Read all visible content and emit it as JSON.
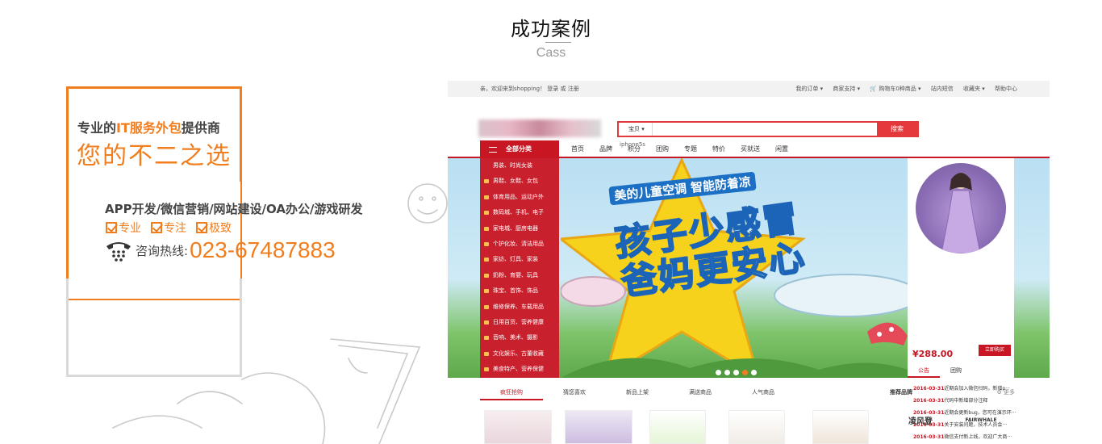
{
  "section": {
    "title": "成功案例",
    "subtitle": "Cass"
  },
  "card": {
    "line1_pre": "专业的",
    "line1_hl": "IT服务外包",
    "line1_post": "提供商",
    "line2": "您的不二之选",
    "services": "APP开发/微信营销/网站建设/OA办公/游戏研发",
    "tags": [
      "专业",
      "专注",
      "极致"
    ],
    "hotline_label": "咨询热线:",
    "hotline_number": "023-67487883"
  },
  "shop": {
    "topbar_left": "亲，欢迎来到shopping！ 登录  或  注册",
    "topbar_right": [
      "我的订单 ▾",
      "商家支持 ▾",
      "🛒 购物车0种商品  ▾",
      "站内短信",
      "收藏夹  ▾",
      "帮助中心"
    ],
    "search_category": "宝贝 ▾",
    "search_button": "搜索",
    "hot_word": "iphone5s",
    "all_categories": "全部分类",
    "nav_links": [
      "首页",
      "品牌",
      "积分",
      "团购",
      "专题",
      "特价",
      "买就送",
      "闲置"
    ],
    "side_menu": [
      "男装、时尚女装",
      "男鞋、女鞋、女包",
      "体育用品、运动户外",
      "数码城、手机、电子",
      "家电城、厨房电器",
      "个护化妆、清洁用品",
      "家纺、灯具、家装",
      "奶粉、育婴、玩具",
      "珠宝、首饰、饰品",
      "维修保养、车载用品",
      "日用百货、营养健康",
      "音响、美术、摄影",
      "文化娱乐、古董收藏",
      "美食特产、营养保健"
    ],
    "banner_line1": "美的儿童空调  智能防着凉",
    "banner_line2": "孩子少感冒",
    "banner_line3": "爸妈更安心",
    "promo_price": "¥288.00",
    "promo_buy": "立即购买",
    "promo_tabs": [
      "公告",
      "团购"
    ],
    "news": [
      {
        "date": "2016-03-31",
        "text": "近期会加入微信扫码，新增p···"
      },
      {
        "date": "2016-03-31",
        "text": "代码中新增部分注释"
      },
      {
        "date": "2016-03-31",
        "text": "近期会更新bug，您可在演示环···"
      },
      {
        "date": "2016-03-31",
        "text": "关于安装问题，技术人员会···"
      },
      {
        "date": "2016-03-31",
        "text": "微信支付新上线，欢迎广大商···"
      }
    ],
    "bottom_tabs": [
      "疯狂抢购",
      "猜您喜欢",
      "新品上架",
      "满送商品",
      "人气商品"
    ],
    "brands_title": "推荐品牌",
    "brands_more": "⚙ 更多",
    "brand_names": [
      "凌风登",
      "FAIRWHALE"
    ],
    "colors": {
      "brand_red": "#c81623",
      "accent_orange": "#f07d1e"
    }
  }
}
